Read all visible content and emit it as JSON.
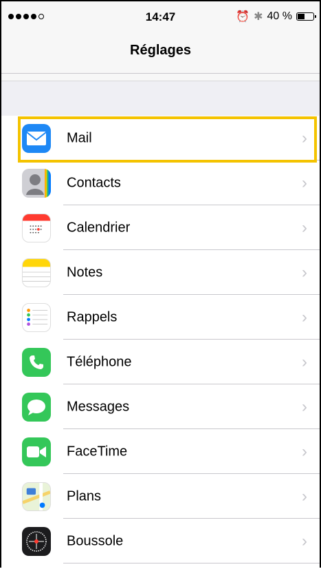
{
  "status_bar": {
    "signal": "signal-strength-icon",
    "time": "14:47",
    "alarm": "alarm-icon",
    "bluetooth": "bluetooth-icon",
    "battery_text": "40 %",
    "battery_icon": "battery-icon"
  },
  "nav": {
    "title": "Réglages"
  },
  "settings": [
    {
      "label": "Mail",
      "icon": "mail-icon",
      "color": "#1e88f5"
    },
    {
      "label": "Contacts",
      "icon": "contacts-icon",
      "color": "#8e8e93"
    },
    {
      "label": "Calendrier",
      "icon": "calendar-icon",
      "color": "#ffffff"
    },
    {
      "label": "Notes",
      "icon": "notes-icon",
      "color": "#ffd60a"
    },
    {
      "label": "Rappels",
      "icon": "reminders-icon",
      "color": "#ffffff"
    },
    {
      "label": "Téléphone",
      "icon": "phone-icon",
      "color": "#34c759"
    },
    {
      "label": "Messages",
      "icon": "messages-icon",
      "color": "#34c759"
    },
    {
      "label": "FaceTime",
      "icon": "facetime-icon",
      "color": "#34c759"
    },
    {
      "label": "Plans",
      "icon": "maps-icon",
      "color": "#f4f1e6"
    },
    {
      "label": "Boussole",
      "icon": "compass-icon",
      "color": "#1c1c1e"
    }
  ],
  "highlight_color": "#f4c300"
}
